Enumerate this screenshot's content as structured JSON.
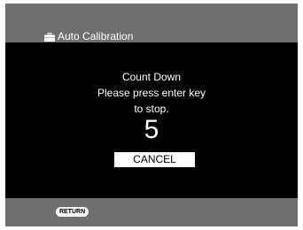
{
  "header": {
    "title": "Auto Calibration",
    "icon": "toolbox-icon"
  },
  "dialog": {
    "line1": "Count Down",
    "line2": "Please press enter key",
    "line3": "to stop.",
    "countdown": "5",
    "cancel_label": "CANCEL"
  },
  "footer": {
    "return_label": "RETURN"
  },
  "colors": {
    "bar": "#6f6f6f",
    "background": "#000000",
    "text": "#ffffff"
  }
}
